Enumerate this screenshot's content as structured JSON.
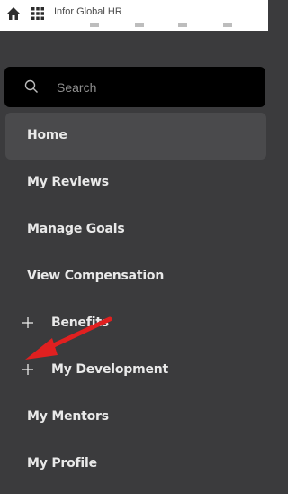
{
  "header": {
    "app_title": "Infor Global HR"
  },
  "search": {
    "placeholder": "Search"
  },
  "nav": {
    "items": [
      {
        "label": "Home",
        "active": true,
        "expandable": false
      },
      {
        "label": "My Reviews",
        "active": false,
        "expandable": false
      },
      {
        "label": "Manage Goals",
        "active": false,
        "expandable": false
      },
      {
        "label": "View Compensation",
        "active": false,
        "expandable": false
      },
      {
        "label": "Benefits",
        "active": false,
        "expandable": true
      },
      {
        "label": "My Development",
        "active": false,
        "expandable": true
      },
      {
        "label": "My Mentors",
        "active": false,
        "expandable": false
      },
      {
        "label": "My Profile",
        "active": false,
        "expandable": false
      }
    ]
  },
  "colors": {
    "sidebar_bg": "#3b3b3d",
    "active_bg": "#4a4a4c",
    "search_bg": "#000000",
    "annotation_arrow": "#e02020"
  },
  "icons": [
    "home-icon",
    "app-grid-icon",
    "search-icon",
    "plus-icon",
    "red-annotation-arrow"
  ]
}
